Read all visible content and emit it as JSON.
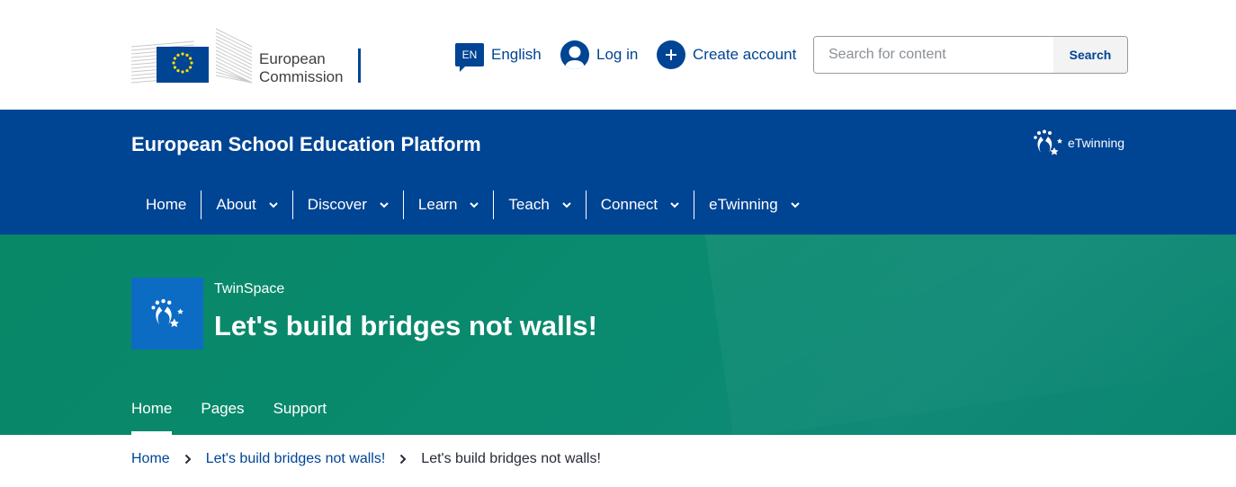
{
  "header": {
    "logo_line1": "European",
    "logo_line2": "Commission",
    "language_code": "EN",
    "language_label": "English",
    "login_label": "Log in",
    "create_account_label": "Create account",
    "search_placeholder": "Search for content",
    "search_button": "Search"
  },
  "band": {
    "site_title": "European School Education Platform",
    "partner_logo_text": "eTwinning",
    "nav": [
      {
        "label": "Home",
        "has_dropdown": false
      },
      {
        "label": "About",
        "has_dropdown": true
      },
      {
        "label": "Discover",
        "has_dropdown": true
      },
      {
        "label": "Learn",
        "has_dropdown": true
      },
      {
        "label": "Teach",
        "has_dropdown": true
      },
      {
        "label": "Connect",
        "has_dropdown": true
      },
      {
        "label": "eTwinning",
        "has_dropdown": true
      }
    ]
  },
  "hero": {
    "kicker": "TwinSpace",
    "title": "Let's build bridges not walls!",
    "tabs": [
      {
        "label": "Home",
        "active": true
      },
      {
        "label": "Pages",
        "active": false
      },
      {
        "label": "Support",
        "active": false
      }
    ]
  },
  "breadcrumb": [
    {
      "label": "Home",
      "current": false
    },
    {
      "label": "Let's build bridges not walls!",
      "current": false
    },
    {
      "label": "Let's build bridges not walls!",
      "current": true
    }
  ],
  "colors": {
    "ec_blue": "#004494",
    "hero_green": "#0a8a70",
    "twinspace_blue": "#0c6cc4",
    "eu_star_yellow": "#ffdd00"
  }
}
